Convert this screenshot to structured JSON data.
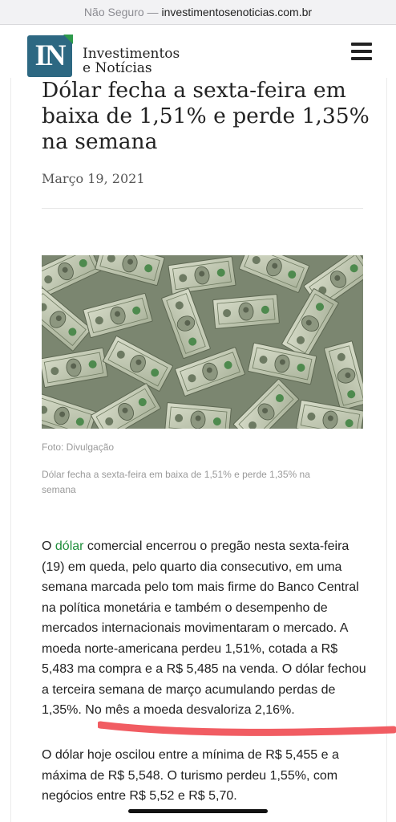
{
  "browser": {
    "security_label": "Não Seguro —",
    "domain": "investimentosenoticias.com.br"
  },
  "header": {
    "logo_mark": "IN",
    "logo_line1": "Investimentos",
    "logo_line2": "e Notícias"
  },
  "article": {
    "title": "Dólar fecha a sexta-feira em baixa de 1,51% e perde 1,35% na semana",
    "date": "Março 19, 2021",
    "image_credit": "Foto: Divulgação",
    "image_caption": "Dólar fecha a sexta-feira em baixa de 1,51% e perde 1,35% na semana",
    "p1_before_link": "O ",
    "p1_link": "dólar",
    "p1_after_link": " comercial encerrou o pregão nesta sexta-feira (19) em queda, pelo quarto dia consecutivo, em uma semana marcada pelo tom mais firme do Banco Central na política monetária e também o desempenho de mercados internacionais movimentaram o mercado. A moeda norte-americana perdeu 1,51%, cotada a R$ 5,483 ma compra e a R$ 5,485 na venda. O dólar fechou a terceira semana de março acumulando perdas de 1,35%. No mês a moeda desvaloriza 2,16%.",
    "p2": "O dólar hoje oscilou entre a mínima de R$ 5,455 e a máxima de R$ 5,548. O turismo perdeu 1,55%, com negócios entre R$ 5,52 e R$ 5,70."
  },
  "colors": {
    "brand_blue": "#2d6882",
    "brand_green": "#2d9a4b",
    "link_green": "#1f8e3b",
    "highlight_marker": "#f04e55"
  },
  "icons": [
    "hamburger-menu-icon"
  ]
}
